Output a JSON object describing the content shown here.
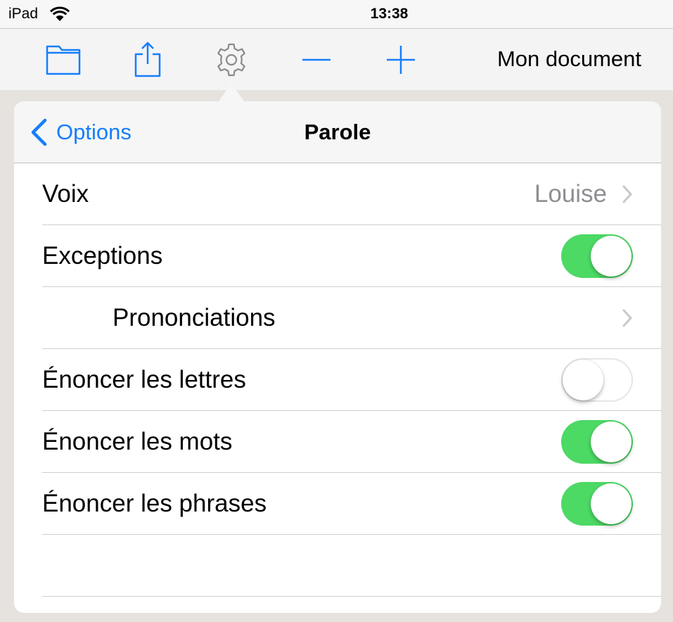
{
  "status_bar": {
    "carrier": "iPad",
    "time": "13:38"
  },
  "toolbar": {
    "document_title": "Mon document",
    "icons": [
      "folder-icon",
      "share-icon",
      "gear-icon",
      "minus-icon",
      "plus-icon"
    ]
  },
  "popover": {
    "back_label": "Options",
    "title": "Parole",
    "rows": [
      {
        "label": "Voix",
        "value": "Louise",
        "accessory": "chevron"
      },
      {
        "label": "Exceptions",
        "accessory": "switch",
        "on": true
      },
      {
        "label": "Prononciations",
        "accessory": "chevron",
        "indented": true
      },
      {
        "label": "Énoncer les lettres",
        "accessory": "switch",
        "on": false
      },
      {
        "label": "Énoncer les mots",
        "accessory": "switch",
        "on": true
      },
      {
        "label": "Énoncer les phrases",
        "accessory": "switch",
        "on": true
      }
    ]
  },
  "colors": {
    "accent": "#157efb",
    "switch_on": "#4cd964",
    "secondary_text": "#8e8e93"
  }
}
